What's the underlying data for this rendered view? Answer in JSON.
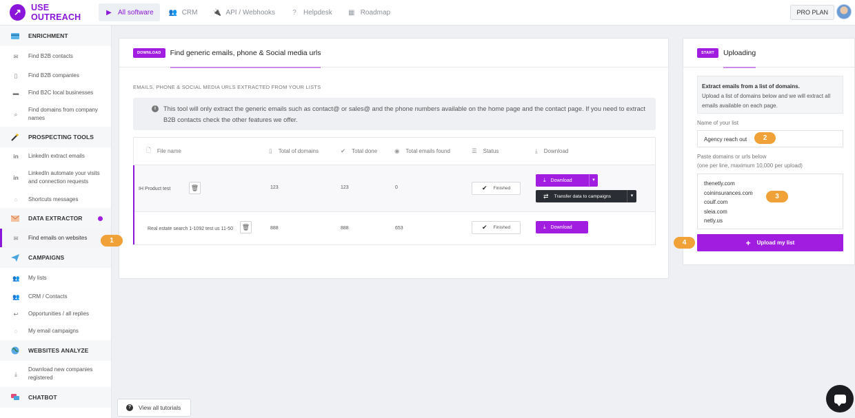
{
  "app": {
    "logo_glyph": "↗",
    "name": "USE OUTREACH"
  },
  "topnav": [
    {
      "icon": "play-icon",
      "glyph": "▶",
      "label": "All software",
      "active": true
    },
    {
      "icon": "users-icon",
      "glyph": "👥",
      "label": "CRM"
    },
    {
      "icon": "plug-icon",
      "glyph": "🔌",
      "label": "API / Webhooks"
    },
    {
      "icon": "question-icon",
      "glyph": "?",
      "label": "Helpdesk"
    },
    {
      "icon": "calendar-icon",
      "glyph": "▦",
      "label": "Roadmap"
    }
  ],
  "plan_label": "PRO PLAN",
  "sidebar": {
    "enrichment": "ENRICHMENT",
    "find_b2b_contacts": "Find B2B contacts",
    "find_b2b_companies": "Find B2B companies",
    "find_b2c_local": "Find B2C local businesses",
    "find_domains": "Find domains from company names",
    "prospecting": "PROSPECTING TOOLS",
    "linkedin_extract": "LinkedIn extract emails",
    "linkedin_automate": "LinkedIn automate your visits and connection requests",
    "shortcuts": "Shortcuts messages",
    "data_extractor": "DATA EXTRACTOR",
    "find_emails_websites": "Find emails on websites",
    "campaigns": "CAMPAIGNS",
    "my_lists": "My lists",
    "crm_contacts": "CRM / Contacts",
    "opportunities": "Opportunities / all replies",
    "my_email_campaigns": "My email campaigns",
    "websites_analyze": "WEBSITES ANALYZE",
    "download_new_companies": "Download new companies registered",
    "chatbot": "CHATBOT"
  },
  "main": {
    "badge": "DOWNLOAD",
    "title": "Find generic emails, phone & Social media urls",
    "subtitle": "EMAILS, PHONE & SOCIAL MEDIA URLS EXTRACTED FROM YOUR LISTS",
    "info_text": "This tool will only extract the generic emails such as contact@ or sales@ and the phone numbers available on the home page and the contact page. If you need to extract B2B contacts check the other features we offer.",
    "columns": [
      "File name",
      "Total of domains",
      "Total done",
      "Total emails found",
      "Status",
      "Download"
    ],
    "rows": [
      {
        "file_name": "IH Product test",
        "total_domains": "123",
        "total_done": "123",
        "emails_found": "0",
        "status": "Finished"
      },
      {
        "file_name": "Real estate search 1-1092 test us 11-50",
        "total_domains": "888",
        "total_done": "888",
        "emails_found": "653",
        "status": "Finished"
      }
    ],
    "download_label": "Download",
    "transfer_label": "Transfer data to campaigns"
  },
  "right": {
    "badge": "START",
    "title": "Uploading",
    "info_bold": "Extract emails from a list of domains.",
    "info_text": "Upload a list of domains below and we will extract all emails available on each page.",
    "name_label": "Name of your list",
    "name_value": "Agency reach out",
    "paste_label_1": "Paste domains or urls below",
    "paste_label_2": "(one per line, maximum 10,000 per upload)",
    "domains": [
      "thenetly.com",
      "coininsurances.com",
      "coulf.com",
      "sleia.com",
      "netly.us"
    ],
    "upload_label": "Upload my list"
  },
  "steps": [
    "1",
    "2",
    "3",
    "4"
  ],
  "tutorials_label": "View all tutorials",
  "colors": {
    "accent": "#a11ee0",
    "brand": "#8a16d9",
    "step": "#f0a137"
  }
}
